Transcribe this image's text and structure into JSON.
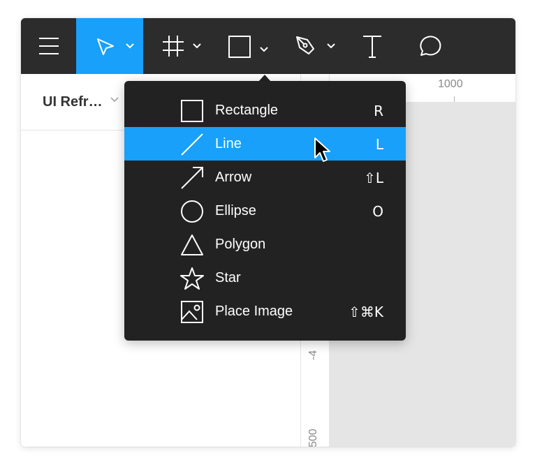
{
  "toolbar": {
    "tools": [
      {
        "name": "menu",
        "icon": "hamburger-menu-icon"
      },
      {
        "name": "move",
        "icon": "move-arrow-icon",
        "active": true,
        "has_dropdown": true
      },
      {
        "name": "frame",
        "icon": "frame-hash-icon",
        "has_dropdown": true
      },
      {
        "name": "shape",
        "icon": "rectangle-icon",
        "has_dropdown": true,
        "menu_open": true
      },
      {
        "name": "pen",
        "icon": "pen-icon",
        "has_dropdown": true
      },
      {
        "name": "text",
        "icon": "text-icon"
      },
      {
        "name": "comment",
        "icon": "comment-icon"
      }
    ],
    "active_color": "#18a0fb",
    "background": "#2c2c2c"
  },
  "left_panel": {
    "page_name": "UI Refr…",
    "page_chevron_icon": "chevron-down-icon"
  },
  "rulers": {
    "top_label": "1000",
    "left_labels": [
      "-4",
      "500"
    ]
  },
  "shape_menu": {
    "items": [
      {
        "label": "Rectangle",
        "shortcut": "R",
        "icon": "rectangle-icon"
      },
      {
        "label": "Line",
        "shortcut": "L",
        "icon": "line-icon",
        "highlighted": true
      },
      {
        "label": "Arrow",
        "shortcut": "⇧L",
        "icon": "arrow-icon"
      },
      {
        "label": "Ellipse",
        "shortcut": "O",
        "icon": "ellipse-icon"
      },
      {
        "label": "Polygon",
        "shortcut": "",
        "icon": "polygon-icon"
      },
      {
        "label": "Star",
        "shortcut": "",
        "icon": "star-icon"
      },
      {
        "label": "Place Image",
        "shortcut": "⇧⌘K",
        "icon": "image-icon"
      }
    ],
    "highlight_color": "#18a0fb",
    "background": "#222222"
  },
  "cursor": {
    "icon": "mouse-pointer-icon"
  }
}
